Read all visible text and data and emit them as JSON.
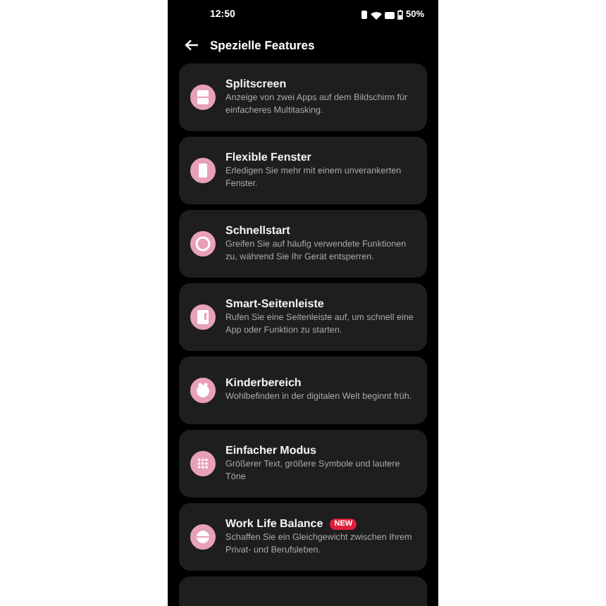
{
  "status_bar": {
    "time": "12:50",
    "battery": "50%"
  },
  "header": {
    "title": "Spezielle Features"
  },
  "features": [
    {
      "title": "Splitscreen",
      "description": "Anzeige von zwei Apps auf dem Bildschirm für einfacheres Multitasking."
    },
    {
      "title": "Flexible Fenster",
      "description": "Erledigen Sie mehr mit einem unverankerten Fenster."
    },
    {
      "title": "Schnellstart",
      "description": "Greifen Sie auf häufig verwendete Funktionen zu, während Sie Ihr Gerät entsperren."
    },
    {
      "title": "Smart-Seitenleiste",
      "description": "Rufen Sie eine Seitenleiste auf, um schnell eine App oder Funktion zu starten."
    },
    {
      "title": "Kinderbereich",
      "description": "Wohlbefinden in der digitalen Welt beginnt früh."
    },
    {
      "title": "Einfacher Modus",
      "description": "Größerer Text, größere Symbole und lautere Töne"
    },
    {
      "title": "Work Life Balance",
      "badge": "NEW",
      "description": "Schaffen Sie ein Gleichgewicht zwischen Ihrem Privat- und Berufsleben."
    }
  ]
}
